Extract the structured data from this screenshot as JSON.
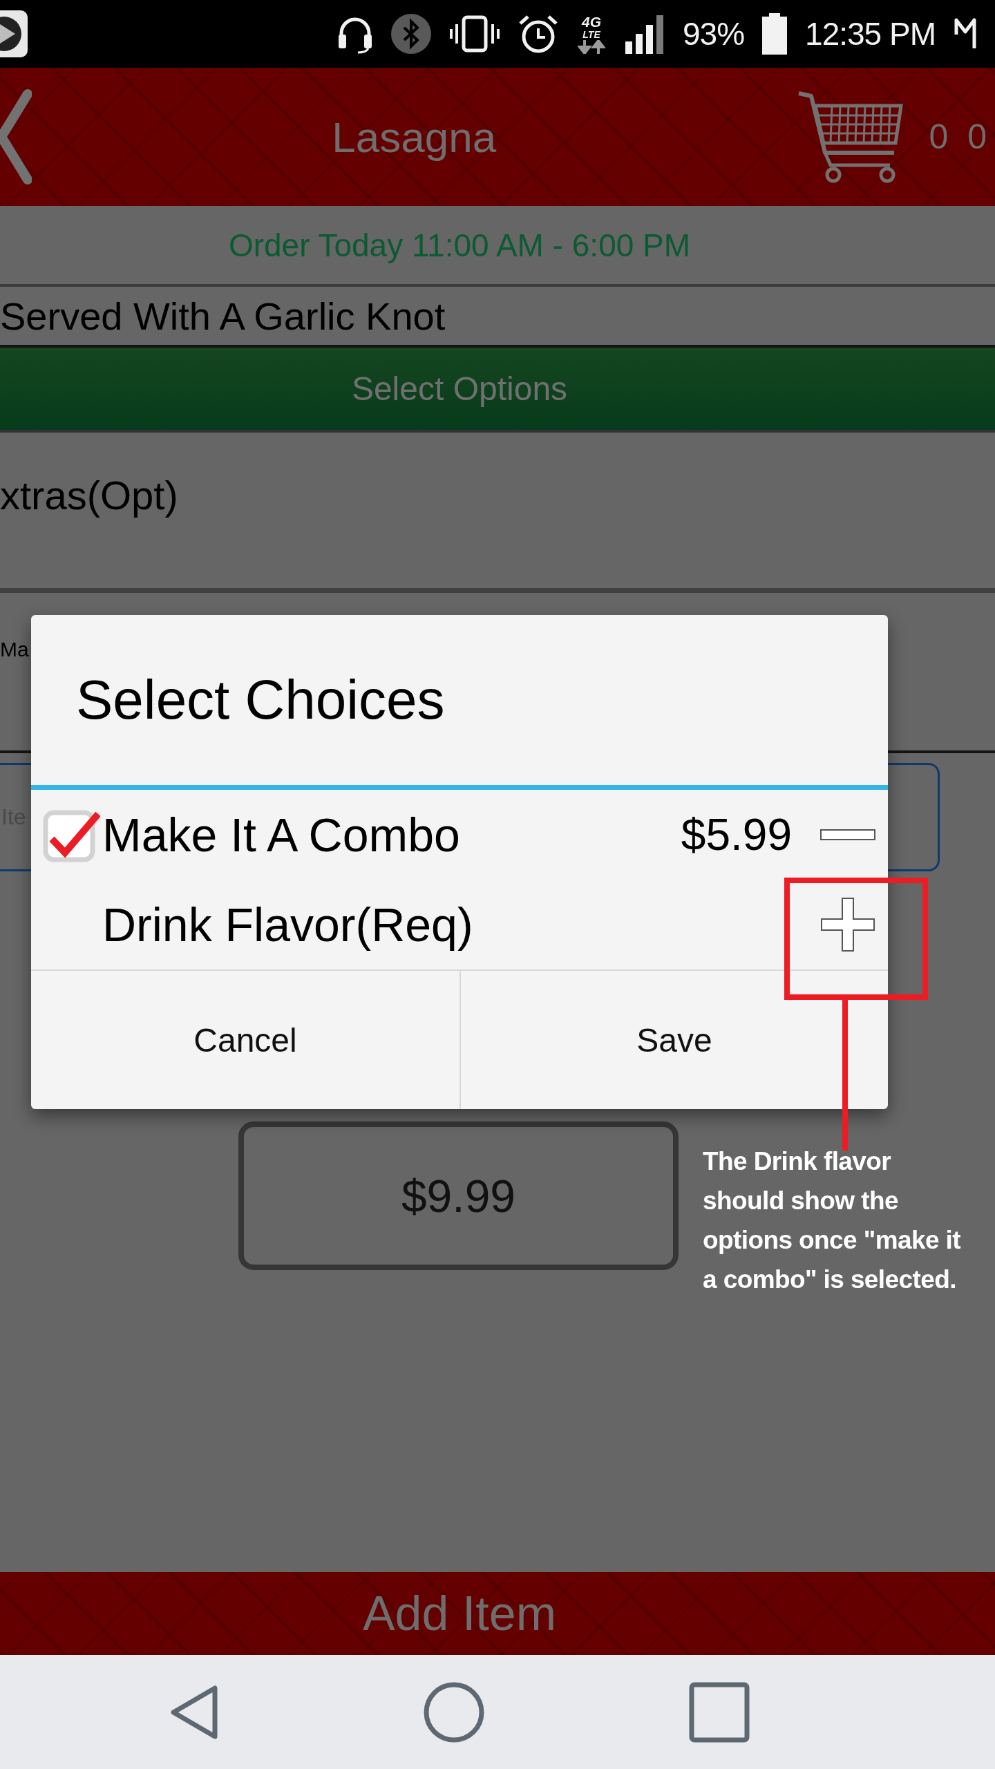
{
  "status_bar": {
    "network": [
      "4G",
      "LTE"
    ],
    "battery": "93%",
    "time": "12:35 PM"
  },
  "header": {
    "title": "Lasagna",
    "cart_count": "0 0"
  },
  "hours": "Order Today 11:00 AM - 6:00 PM",
  "description": "Served With A Garlic Knot",
  "section_header": "Select Options",
  "option_groups": [
    {
      "label": "xtras(Opt)"
    },
    {
      "label": "Ma"
    }
  ],
  "note_field": {
    "placeholder": "Ite"
  },
  "total": "$9.99",
  "add_button": "Add Item",
  "dialog": {
    "title": "Select Choices",
    "choices": [
      {
        "kind": "checkbox",
        "label": "Make It A Combo",
        "checked": true,
        "price": "$5.99",
        "expanded": true
      },
      {
        "kind": "group",
        "label": "Drink Flavor(Req)",
        "expanded": false
      }
    ],
    "buttons": [
      "Cancel",
      "Save"
    ]
  },
  "annotation": "The Drink flavor\nshould show the\noptions once \"make it\na combo\" is selected."
}
